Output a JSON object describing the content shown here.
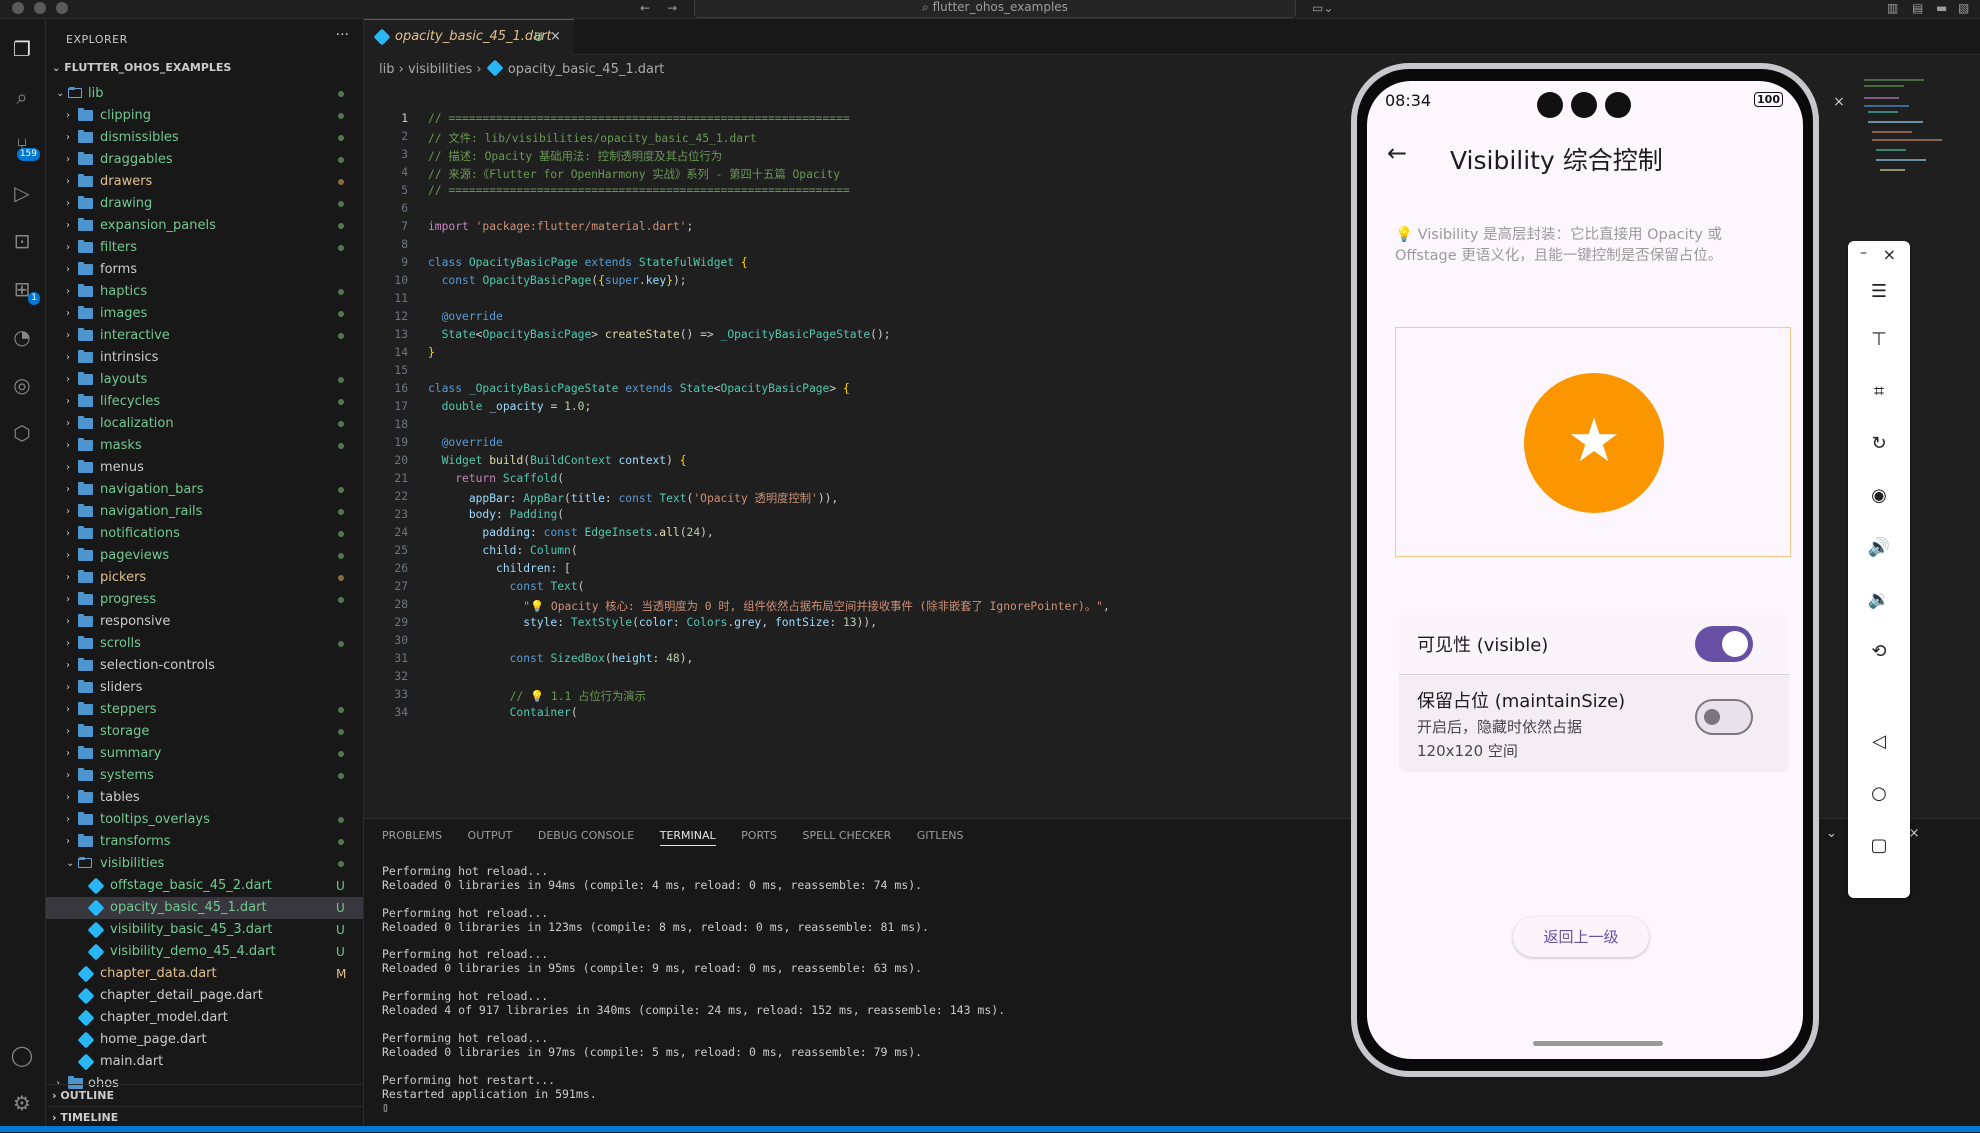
{
  "titlebar": {
    "search": "flutter_ohos_examples"
  },
  "activity": {
    "scm_badge": "159",
    "ext_badge": "1"
  },
  "sidebar": {
    "title": "EXPLORER",
    "root": "FLUTTER_OHOS_EXAMPLES",
    "lib": "lib",
    "folders": [
      "clipping",
      "dismissibles",
      "draggables",
      "drawers",
      "drawing",
      "expansion_panels",
      "filters",
      "forms",
      "haptics",
      "images",
      "interactive",
      "intrinsics",
      "layouts",
      "lifecycles",
      "localization",
      "masks",
      "menus",
      "navigation_bars",
      "navigation_rails",
      "notifications",
      "pageviews",
      "pickers",
      "progress",
      "responsive",
      "scrolls",
      "selection-controls",
      "sliders",
      "steppers",
      "storage",
      "summary",
      "systems",
      "tables",
      "tooltips_overlays",
      "transforms",
      "visibilities"
    ],
    "vis_files": [
      {
        "name": "offstage_basic_45_2.dart",
        "badge": "U"
      },
      {
        "name": "opacity_basic_45_1.dart",
        "badge": "U"
      },
      {
        "name": "visibility_basic_45_3.dart",
        "badge": "U"
      },
      {
        "name": "visibility_demo_45_4.dart",
        "badge": "U"
      }
    ],
    "lib_files": [
      {
        "name": "chapter_data.dart",
        "badge": "M"
      },
      {
        "name": "chapter_detail_page.dart",
        "badge": ""
      },
      {
        "name": "chapter_model.dart",
        "badge": ""
      },
      {
        "name": "home_page.dart",
        "badge": ""
      },
      {
        "name": "main.dart",
        "badge": ""
      }
    ],
    "ohos": "ohos",
    "outline": "OUTLINE",
    "timeline": "TIMELINE"
  },
  "editor": {
    "tab": "opacity_basic_45_1.dart",
    "tab_badge": "U",
    "breadcrumb": [
      "lib",
      "visibilities",
      "opacity_basic_45_1.dart"
    ]
  },
  "panel": {
    "tabs": [
      "PROBLEMS",
      "OUTPUT",
      "DEBUG CONSOLE",
      "TERMINAL",
      "PORTS",
      "SPELL CHECKER",
      "GITLENS"
    ],
    "terminal": "Performing hot reload...\nReloaded 0 libraries in 94ms (compile: 4 ms, reload: 0 ms, reassemble: 74 ms).\n\nPerforming hot reload...\nReloaded 0 libraries in 123ms (compile: 8 ms, reload: 0 ms, reassemble: 81 ms).\n\nPerforming hot reload...\nReloaded 0 libraries in 95ms (compile: 9 ms, reload: 0 ms, reassemble: 63 ms).\n\nPerforming hot reload...\nReloaded 4 of 917 libraries in 340ms (compile: 24 ms, reload: 152 ms, reassemble: 143 ms).\n\nPerforming hot reload...\nReloaded 0 libraries in 97ms (compile: 5 ms, reload: 0 ms, reassemble: 79 ms).\n\nPerforming hot restart...\nRestarted application in 591ms.\n▯"
  },
  "phone": {
    "time": "08:34",
    "battery": "100",
    "title": "Visibility 综合控制",
    "hint": "💡 Visibility 是高层封装：它比直接用 Opacity 或 Offstage 更语义化，且能一键控制是否保留占位。",
    "switch1_label": "可见性 (visible)",
    "switch1_on": true,
    "switch2_label": "保留占位 (maintainSize)",
    "switch2_sub": "开启后，隐藏时依然占据 120x120 空间",
    "switch2_on": false,
    "return_button": "返回上一级"
  },
  "colors": {
    "accent": "#0078d4",
    "orange": "#fb9500",
    "switch_on": "#6750a4"
  }
}
